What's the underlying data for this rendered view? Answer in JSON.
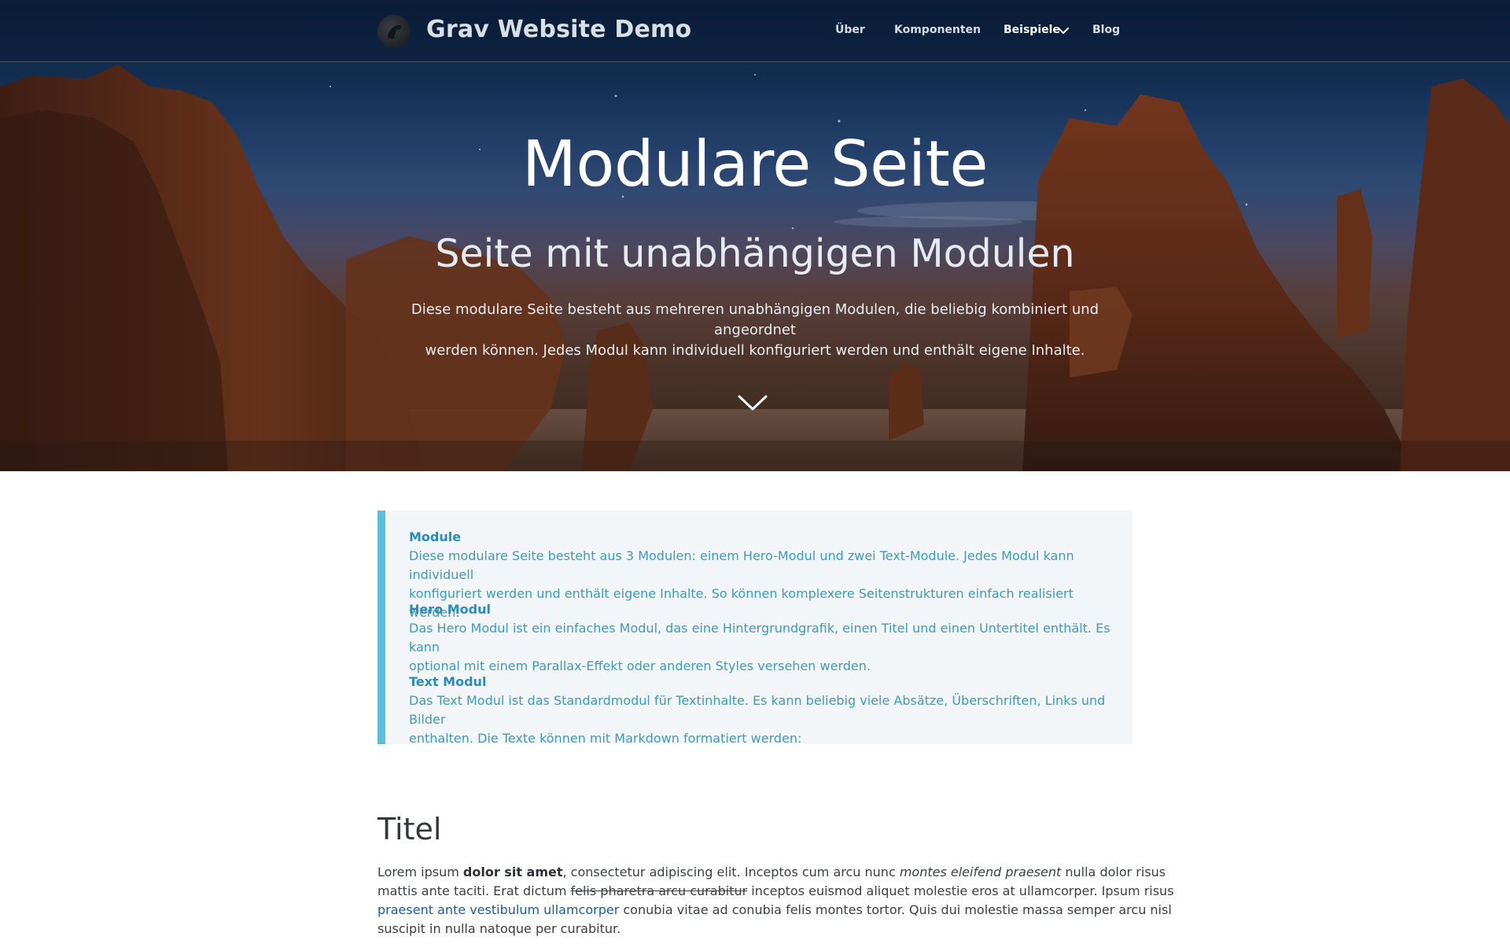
{
  "header": {
    "brand": "Grav Website Demo",
    "logo_icon": "grav-logo-icon",
    "nav": [
      {
        "label": "Über",
        "active": false
      },
      {
        "label": "Komponenten",
        "active": false
      },
      {
        "label": "Beispiele",
        "active": true,
        "has_dropdown": true
      },
      {
        "label": "Blog",
        "active": false
      }
    ]
  },
  "hero": {
    "title": "Modulare Seite",
    "subtitle": "Seite mit unabhängigen Modulen",
    "description_line1": "Diese modulare Seite besteht aus mehreren unabhängigen Modulen, die beliebig kombiniert und angeordnet",
    "description_line2": "werden können. Jedes Modul kann individuell konfiguriert werden und enthält eigene Inhalte.",
    "scroll_icon": "chevron-down-icon"
  },
  "notice": {
    "accent_color": "#5bbfd8",
    "blocks": [
      {
        "title": "Module",
        "line1": "Diese modulare Seite besteht aus 3 Modulen: einem Hero-Modul und zwei Text-Module. Jedes Modul kann individuell",
        "line2": "konfiguriert werden und enthält eigene Inhalte. So können komplexere Seitenstrukturen einfach realisiert werden."
      },
      {
        "title": "Hero Modul",
        "line1": "Das Hero Modul ist ein einfaches Modul, das eine Hintergrundgrafik, einen Titel und einen Untertitel enthält. Es kann",
        "line2": "optional mit einem Parallax-Effekt oder anderen Styles versehen werden."
      },
      {
        "title": "Text Modul",
        "line1": "Das Text Modul ist das Standardmodul für Textinhalte. Es kann beliebig viele Absätze, Überschriften, Links und Bilder",
        "line2": "enthalten. Die Texte können mit Markdown formatiert werden:"
      }
    ]
  },
  "content": {
    "title": "Titel",
    "p1": "Lorem ipsum ",
    "p1_bold": "dolor sit amet",
    "p1b": ", consectetur adipiscing elit. Inceptos cum arcu nunc ",
    "p1_italic": "montes eleifend praesent",
    "p1c": " nulla dolor risus",
    "p2": "mattis ante taciti. Erat dictum ",
    "p2_strike": "felis pharetra arcu curabitur",
    "p2b": " inceptos euismod aliquet molestie eros at ullamcorper. Ipsum risus",
    "p3_link": "praesent ante vestibulum ullamcorper",
    "p3b": " conubia vitae ad conubia felis montes tortor. Quis dui molestie massa semper arcu nisl",
    "p4": "suscipit in nulla natoque per curabitur."
  }
}
